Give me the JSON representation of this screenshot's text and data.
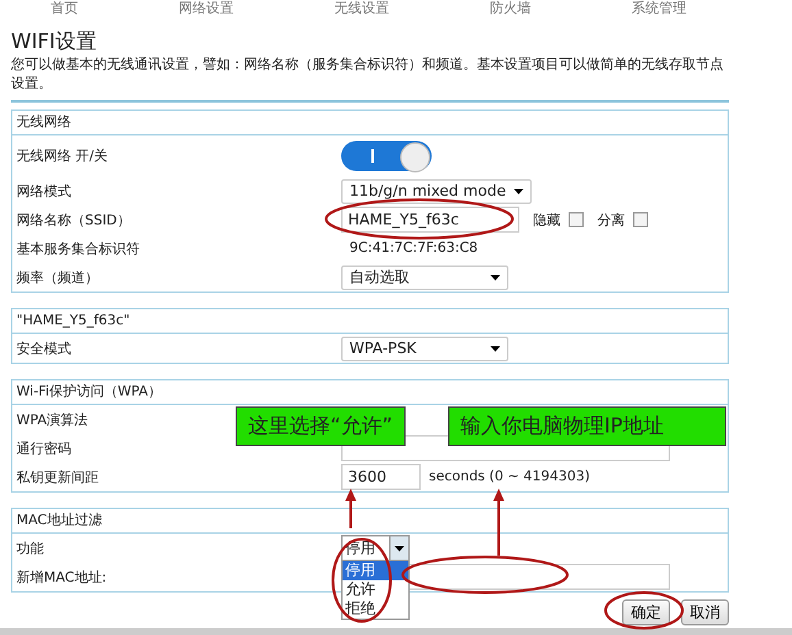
{
  "nav": [
    "首页",
    "网络设置",
    "无线设置",
    "防火墙",
    "系统管理"
  ],
  "title": "WIFI设置",
  "description": "您可以做基本的无线通讯设置，譬如：网络名称（服务集合标识符）和频道。基本设置项目可以做简单的无线存取节点设置。",
  "sections": [
    {
      "header": "无线网络",
      "rows": [
        {
          "kind": "toggle",
          "label": "无线网络 开/关",
          "on": true
        },
        {
          "kind": "select",
          "label": "网络模式",
          "value": "11b/g/n mixed mode"
        },
        {
          "kind": "ssid",
          "label": "网络名称（SSID）",
          "value": "HAME_Y5_f63c",
          "checks": [
            {
              "label": "隐藏",
              "checked": false
            },
            {
              "label": "分离",
              "checked": false
            }
          ]
        },
        {
          "kind": "static",
          "label": "基本服务集合标识符",
          "value": "9C:41:7C:7F:63:C8"
        },
        {
          "kind": "select",
          "label": "频率（频道）",
          "value": "自动选取"
        }
      ]
    },
    {
      "header": "\"HAME_Y5_f63c\"",
      "rows": [
        {
          "kind": "select",
          "label": "安全模式",
          "value": "WPA-PSK"
        }
      ]
    },
    {
      "header": "Wi-Fi保护访问（WPA）",
      "rows": [
        {
          "kind": "none",
          "label": "WPA演算法"
        },
        {
          "kind": "field",
          "label": "通行密码"
        },
        {
          "kind": "suffix",
          "label": "私钥更新间距",
          "value": "3600",
          "suffix": "seconds  (0 ~ 4194303)"
        }
      ]
    },
    {
      "header": "MAC地址过滤",
      "rows": [
        {
          "kind": "dropdown",
          "label": "功能",
          "value": "停用",
          "options": [
            {
              "label": "停用",
              "selected": true
            },
            {
              "label": "允许",
              "selected": false
            },
            {
              "label": "拒绝",
              "selected": false
            }
          ]
        },
        {
          "kind": "field",
          "label": "新增MAC地址:"
        }
      ]
    }
  ],
  "buttons": [
    "确定",
    "取消"
  ],
  "callouts": [
    "这里选择“允许”",
    "输入你电脑物理IP地址"
  ]
}
